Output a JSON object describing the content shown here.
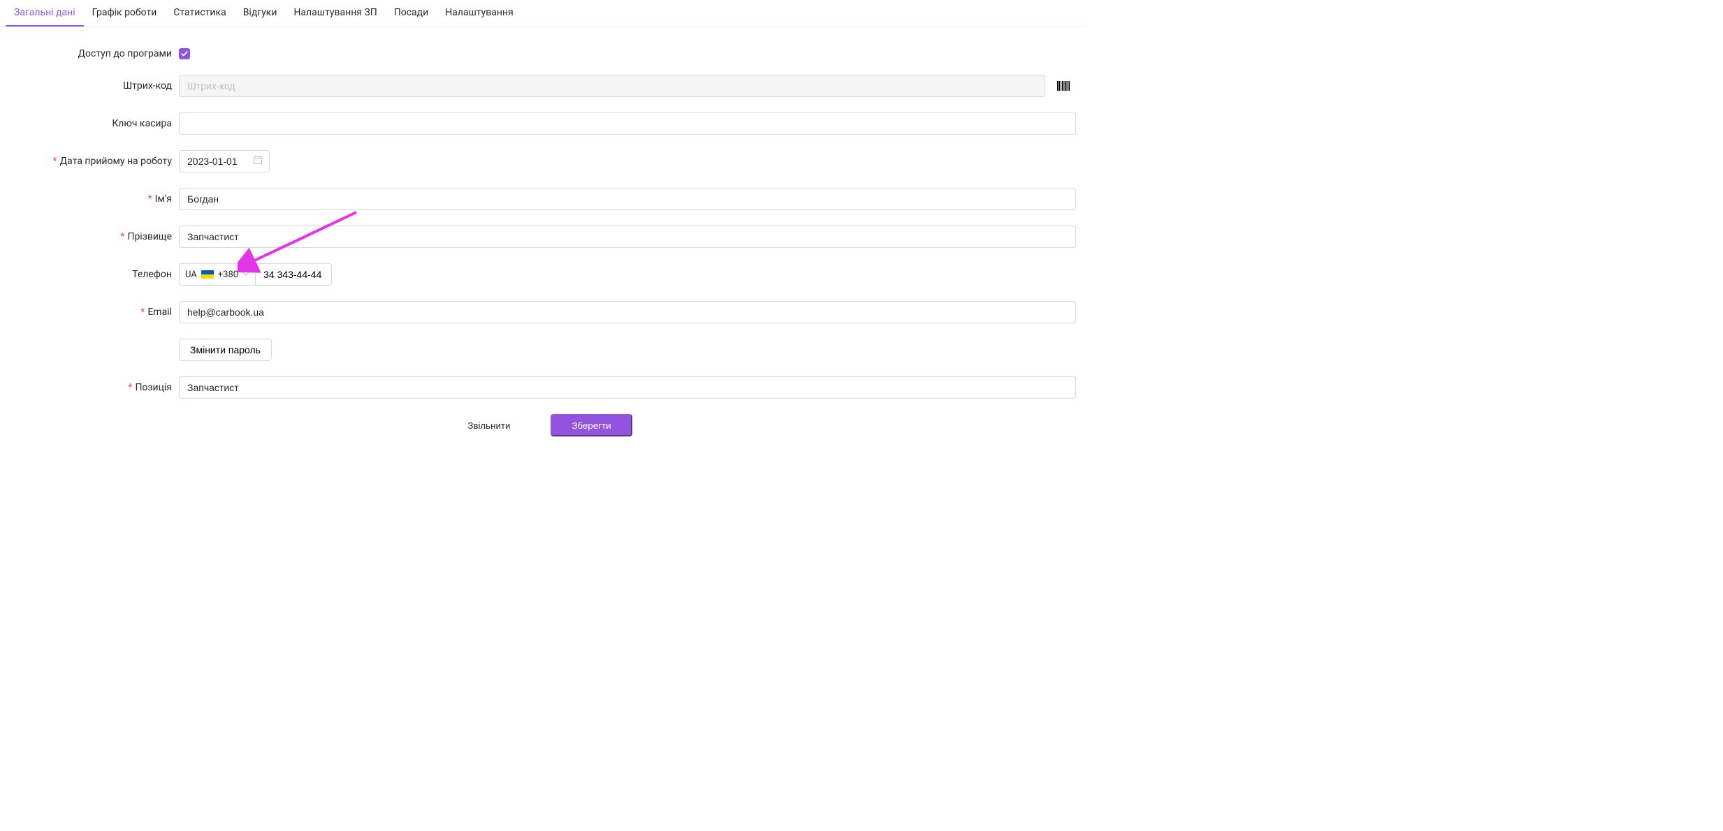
{
  "tabs": [
    {
      "label": "Загальні дані",
      "active": true
    },
    {
      "label": "Графік роботи",
      "active": false
    },
    {
      "label": "Статистика",
      "active": false
    },
    {
      "label": "Відгуки",
      "active": false
    },
    {
      "label": "Налаштування ЗП",
      "active": false
    },
    {
      "label": "Посади",
      "active": false
    },
    {
      "label": "Налаштування",
      "active": false
    }
  ],
  "labels": {
    "access": "Доступ до програми",
    "barcode": "Штрих-код",
    "cashier_key": "Ключ касира",
    "hire_date": "Дата прийому на роботу",
    "first_name": "Ім'я",
    "last_name": "Прізвище",
    "phone": "Телефон",
    "email": "Email",
    "position": "Позиція"
  },
  "placeholders": {
    "barcode": "Штрих-код"
  },
  "values": {
    "access_checked": true,
    "barcode": "",
    "cashier_key": "",
    "hire_date": "2023-01-01",
    "first_name": "Богдан",
    "last_name": "Запчастист",
    "phone_country": "UA",
    "phone_prefix": "+380",
    "phone_number": "34 343-44-44",
    "email": "help@carbook.ua",
    "position": "Запчастист"
  },
  "buttons": {
    "change_password": "Змінити пароль",
    "dismiss": "Звільнити",
    "save": "Зберегти"
  },
  "colors": {
    "accent": "#9254de",
    "arrow": "#e336e9"
  }
}
